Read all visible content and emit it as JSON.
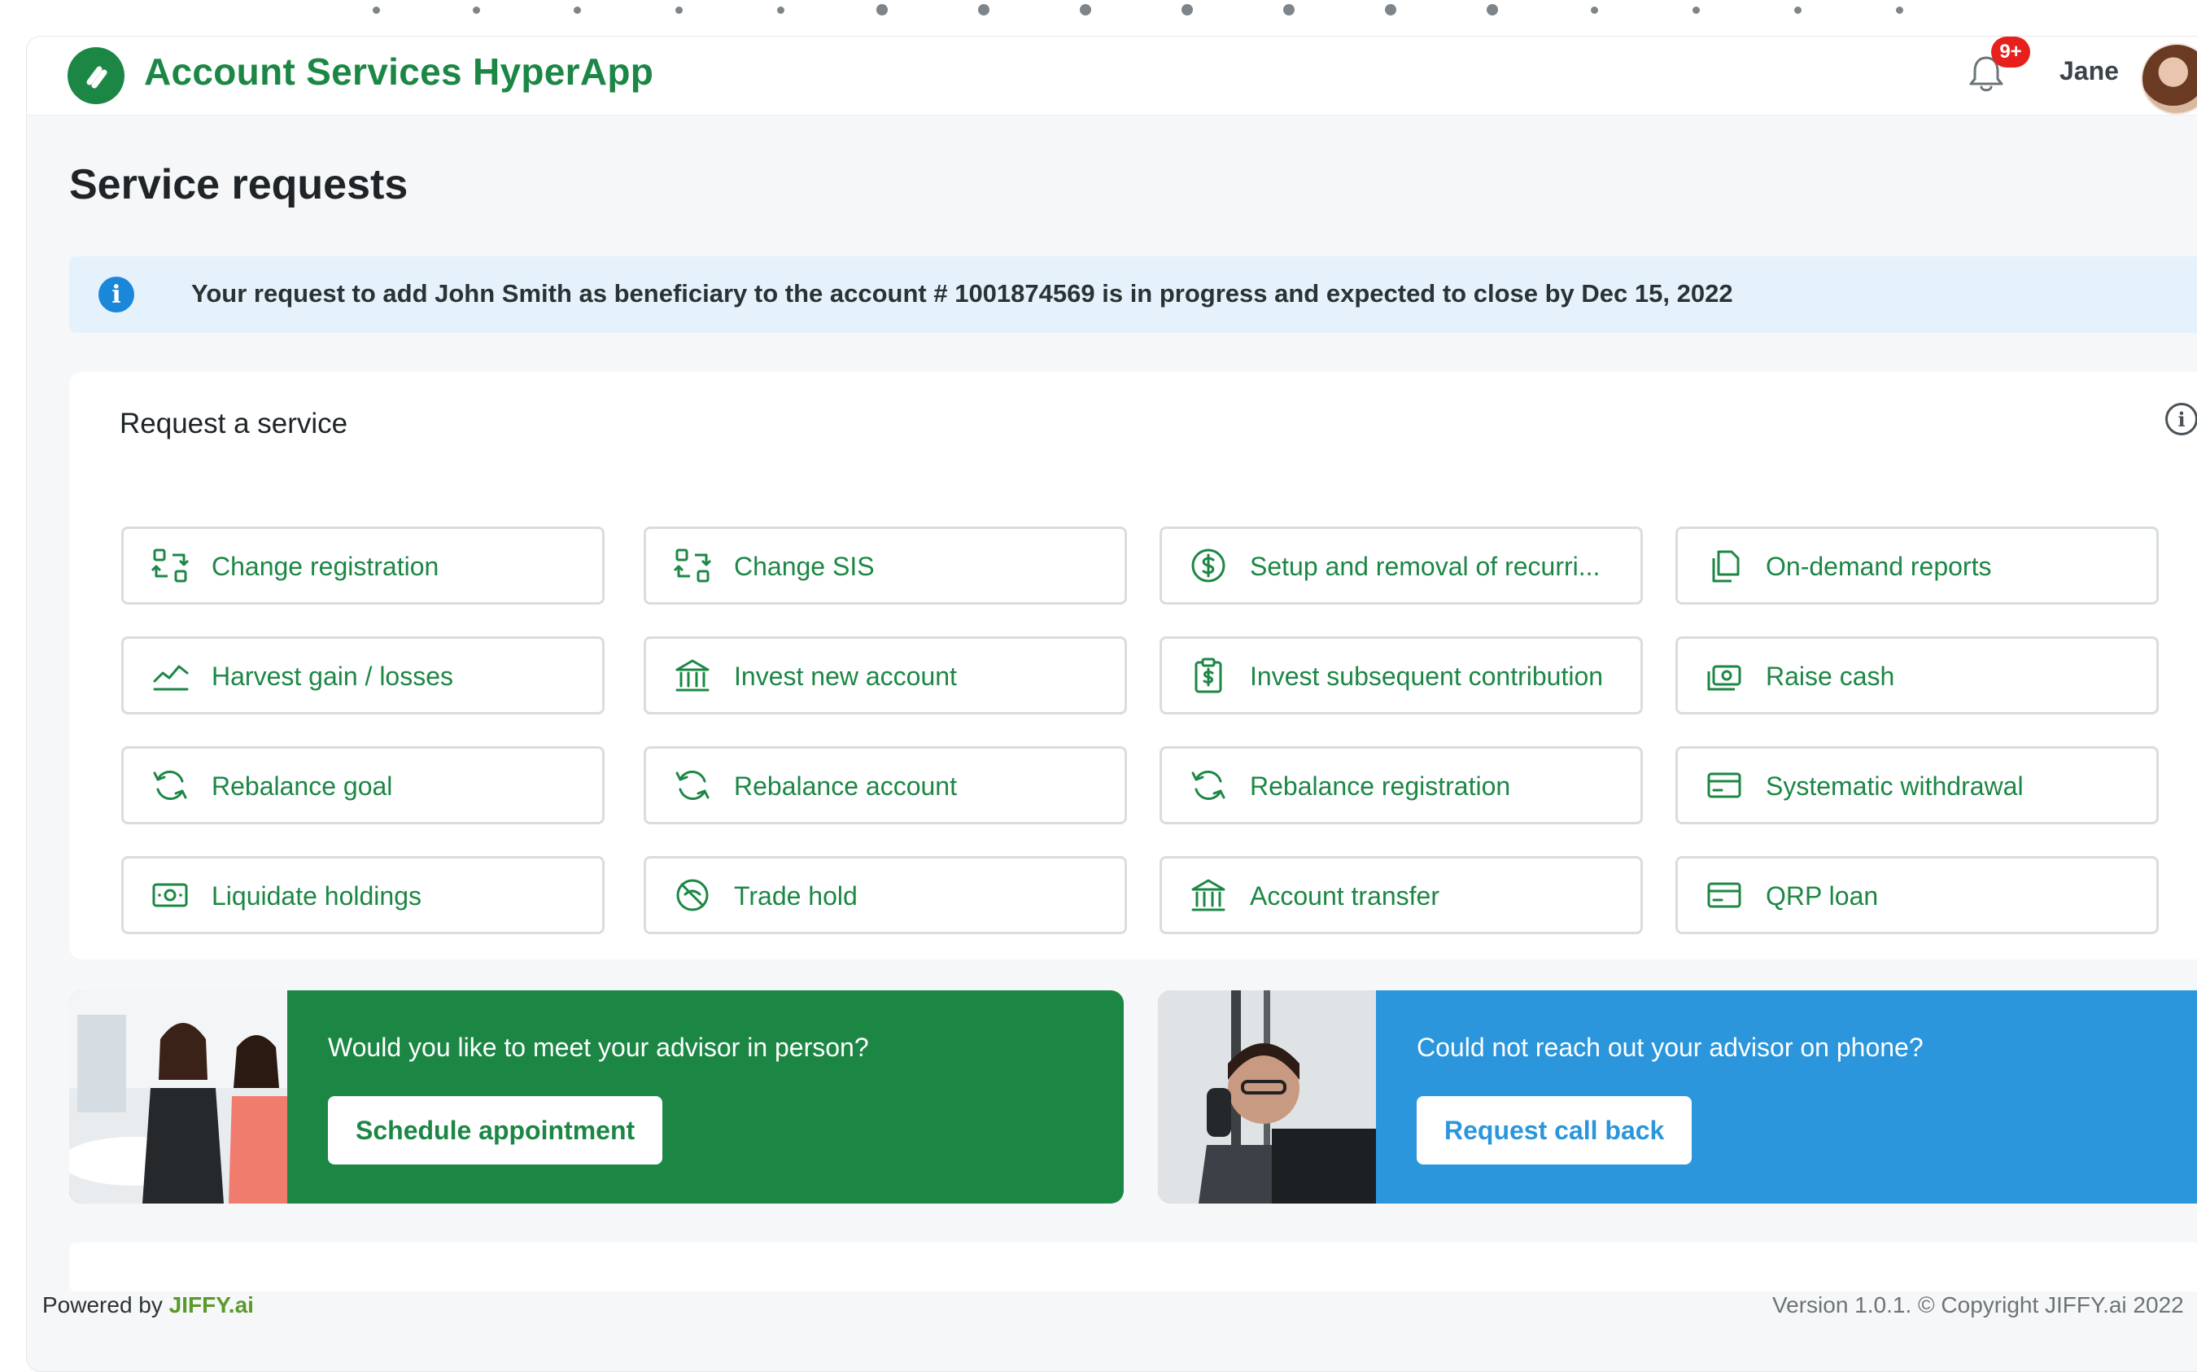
{
  "app": {
    "title": "Account Services HyperApp",
    "notification_count": "9+",
    "user_name": "Jane",
    "brand_color": "#1c8745"
  },
  "page": {
    "title": "Service requests"
  },
  "banner": {
    "text": "Your request to add John Smith as beneficiary to the account # 1001874569 is in progress and expected to close by Dec 15, 2022",
    "icon": "info-icon"
  },
  "services": {
    "title": "Request a service",
    "items": [
      {
        "label": "Change registration",
        "icon": "swap-icon"
      },
      {
        "label": "Change SIS",
        "icon": "swap-icon"
      },
      {
        "label": "Setup and removal of recurri...",
        "icon": "dollar-circle-icon"
      },
      {
        "label": "On-demand reports",
        "icon": "copy-document-icon"
      },
      {
        "label": "Harvest gain / losses",
        "icon": "trend-line-icon"
      },
      {
        "label": "Invest new account",
        "icon": "bank-icon"
      },
      {
        "label": "Invest subsequent contribution",
        "icon": "clipboard-dollar-icon"
      },
      {
        "label": "Raise cash",
        "icon": "cash-stack-icon"
      },
      {
        "label": "Rebalance goal",
        "icon": "refresh-icon"
      },
      {
        "label": "Rebalance account",
        "icon": "refresh-icon"
      },
      {
        "label": "Rebalance registration",
        "icon": "refresh-icon"
      },
      {
        "label": "Systematic withdrawal",
        "icon": "card-icon"
      },
      {
        "label": "Liquidate holdings",
        "icon": "banknote-icon"
      },
      {
        "label": "Trade hold",
        "icon": "block-icon"
      },
      {
        "label": "Account transfer",
        "icon": "bank-icon"
      },
      {
        "label": "QRP loan",
        "icon": "card-icon"
      }
    ]
  },
  "promos": {
    "meet": {
      "question": "Would you like to meet your advisor in person?",
      "button": "Schedule appointment",
      "color": "#1c8745"
    },
    "callback": {
      "question": "Could not reach out your advisor on phone?",
      "button": "Request call back",
      "color": "#2b96db"
    }
  },
  "footer": {
    "powered_by": "Powered by",
    "brand": "JIFFY.ai",
    "version": "Version 1.0.1. © Copyright JIFFY.ai 2022"
  }
}
